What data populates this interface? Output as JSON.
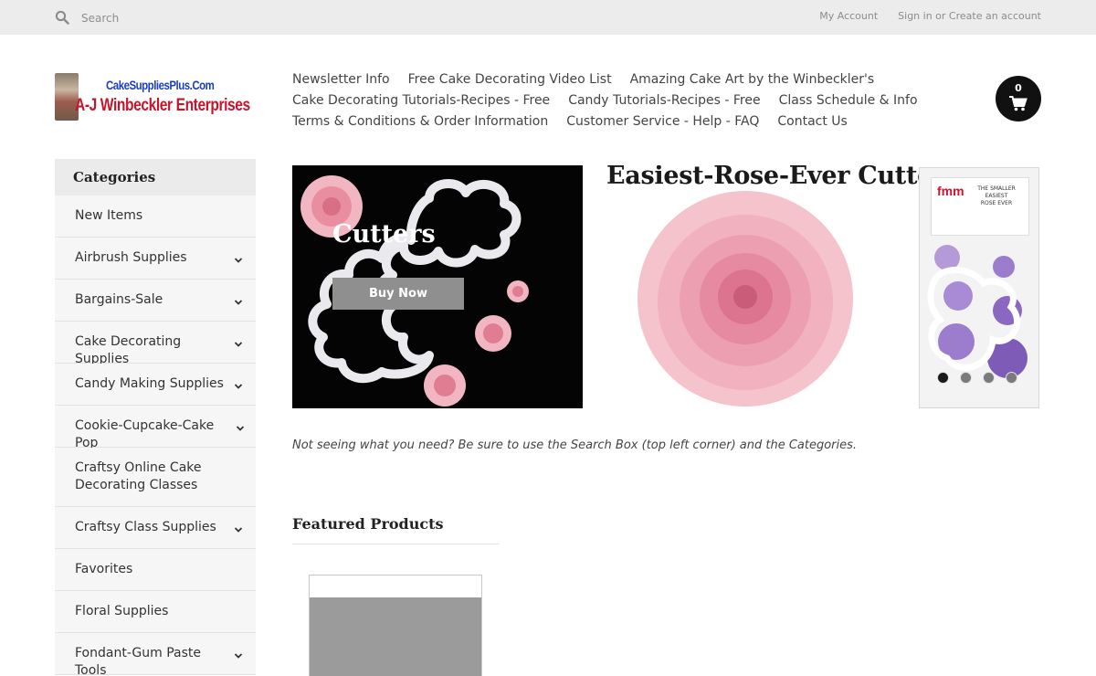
{
  "search": {
    "placeholder": "Search",
    "icon": "search-icon"
  },
  "top_links": {
    "my_account": "My Account",
    "sign_in": "Sign in or Create an account"
  },
  "logo": {
    "line1": "CakeSuppliesPlus.Com",
    "line2": "A-J Winbeckler Enterprises"
  },
  "nav": {
    "rows": [
      [
        "Newsletter Info",
        "Free Cake Decorating Video List",
        "Amazing Cake Art by the Winbeckler's"
      ],
      [
        "Cake Decorating Tutorials-Recipes - Free",
        "Candy Tutorials-Recipes - Free",
        "Class Schedule & Info"
      ],
      [
        "Terms & Conditions & Order Information",
        "Customer Service - Help - FAQ",
        "Contact Us"
      ]
    ]
  },
  "cart": {
    "count": "0",
    "icon": "cart-icon"
  },
  "sidebar": {
    "title": "Categories",
    "items": [
      {
        "label": "New Items",
        "expandable": false
      },
      {
        "label": "Airbrush Supplies",
        "expandable": true
      },
      {
        "label": "Bargains-Sale",
        "expandable": true
      },
      {
        "label": "Cake Decorating Supplies",
        "expandable": true
      },
      {
        "label": "Candy Making Supplies",
        "expandable": true
      },
      {
        "label": "Cookie-Cupcake-Cake Pop",
        "expandable": true
      },
      {
        "label": "Craftsy Online Cake Decorating Classes",
        "expandable": false
      },
      {
        "label": "Craftsy Class Supplies",
        "expandable": true
      },
      {
        "label": "Favorites",
        "expandable": false
      },
      {
        "label": "Floral Supplies",
        "expandable": false
      },
      {
        "label": "Fondant-Gum Paste Tools",
        "expandable": true
      }
    ]
  },
  "banner": {
    "caption": "Cutters",
    "buy_label": "Buy Now",
    "title": "Easiest-Rose-Ever Cutters",
    "package_brand": "fmm",
    "package_text": [
      "THE SMALLER",
      "EASIEST",
      "ROSE EVER"
    ],
    "slide_count": 4,
    "active_slide": 1
  },
  "notice": "Not seeing what you need? Be sure to use the Search Box (top left corner) and the Categories.",
  "featured": {
    "title": "Featured Products"
  },
  "colors": {
    "topbar": "#ececec",
    "sidebar": "#f6f6f6",
    "button": "#8f8f8f",
    "cart": "#111111",
    "rose": "#f2b6c2"
  }
}
